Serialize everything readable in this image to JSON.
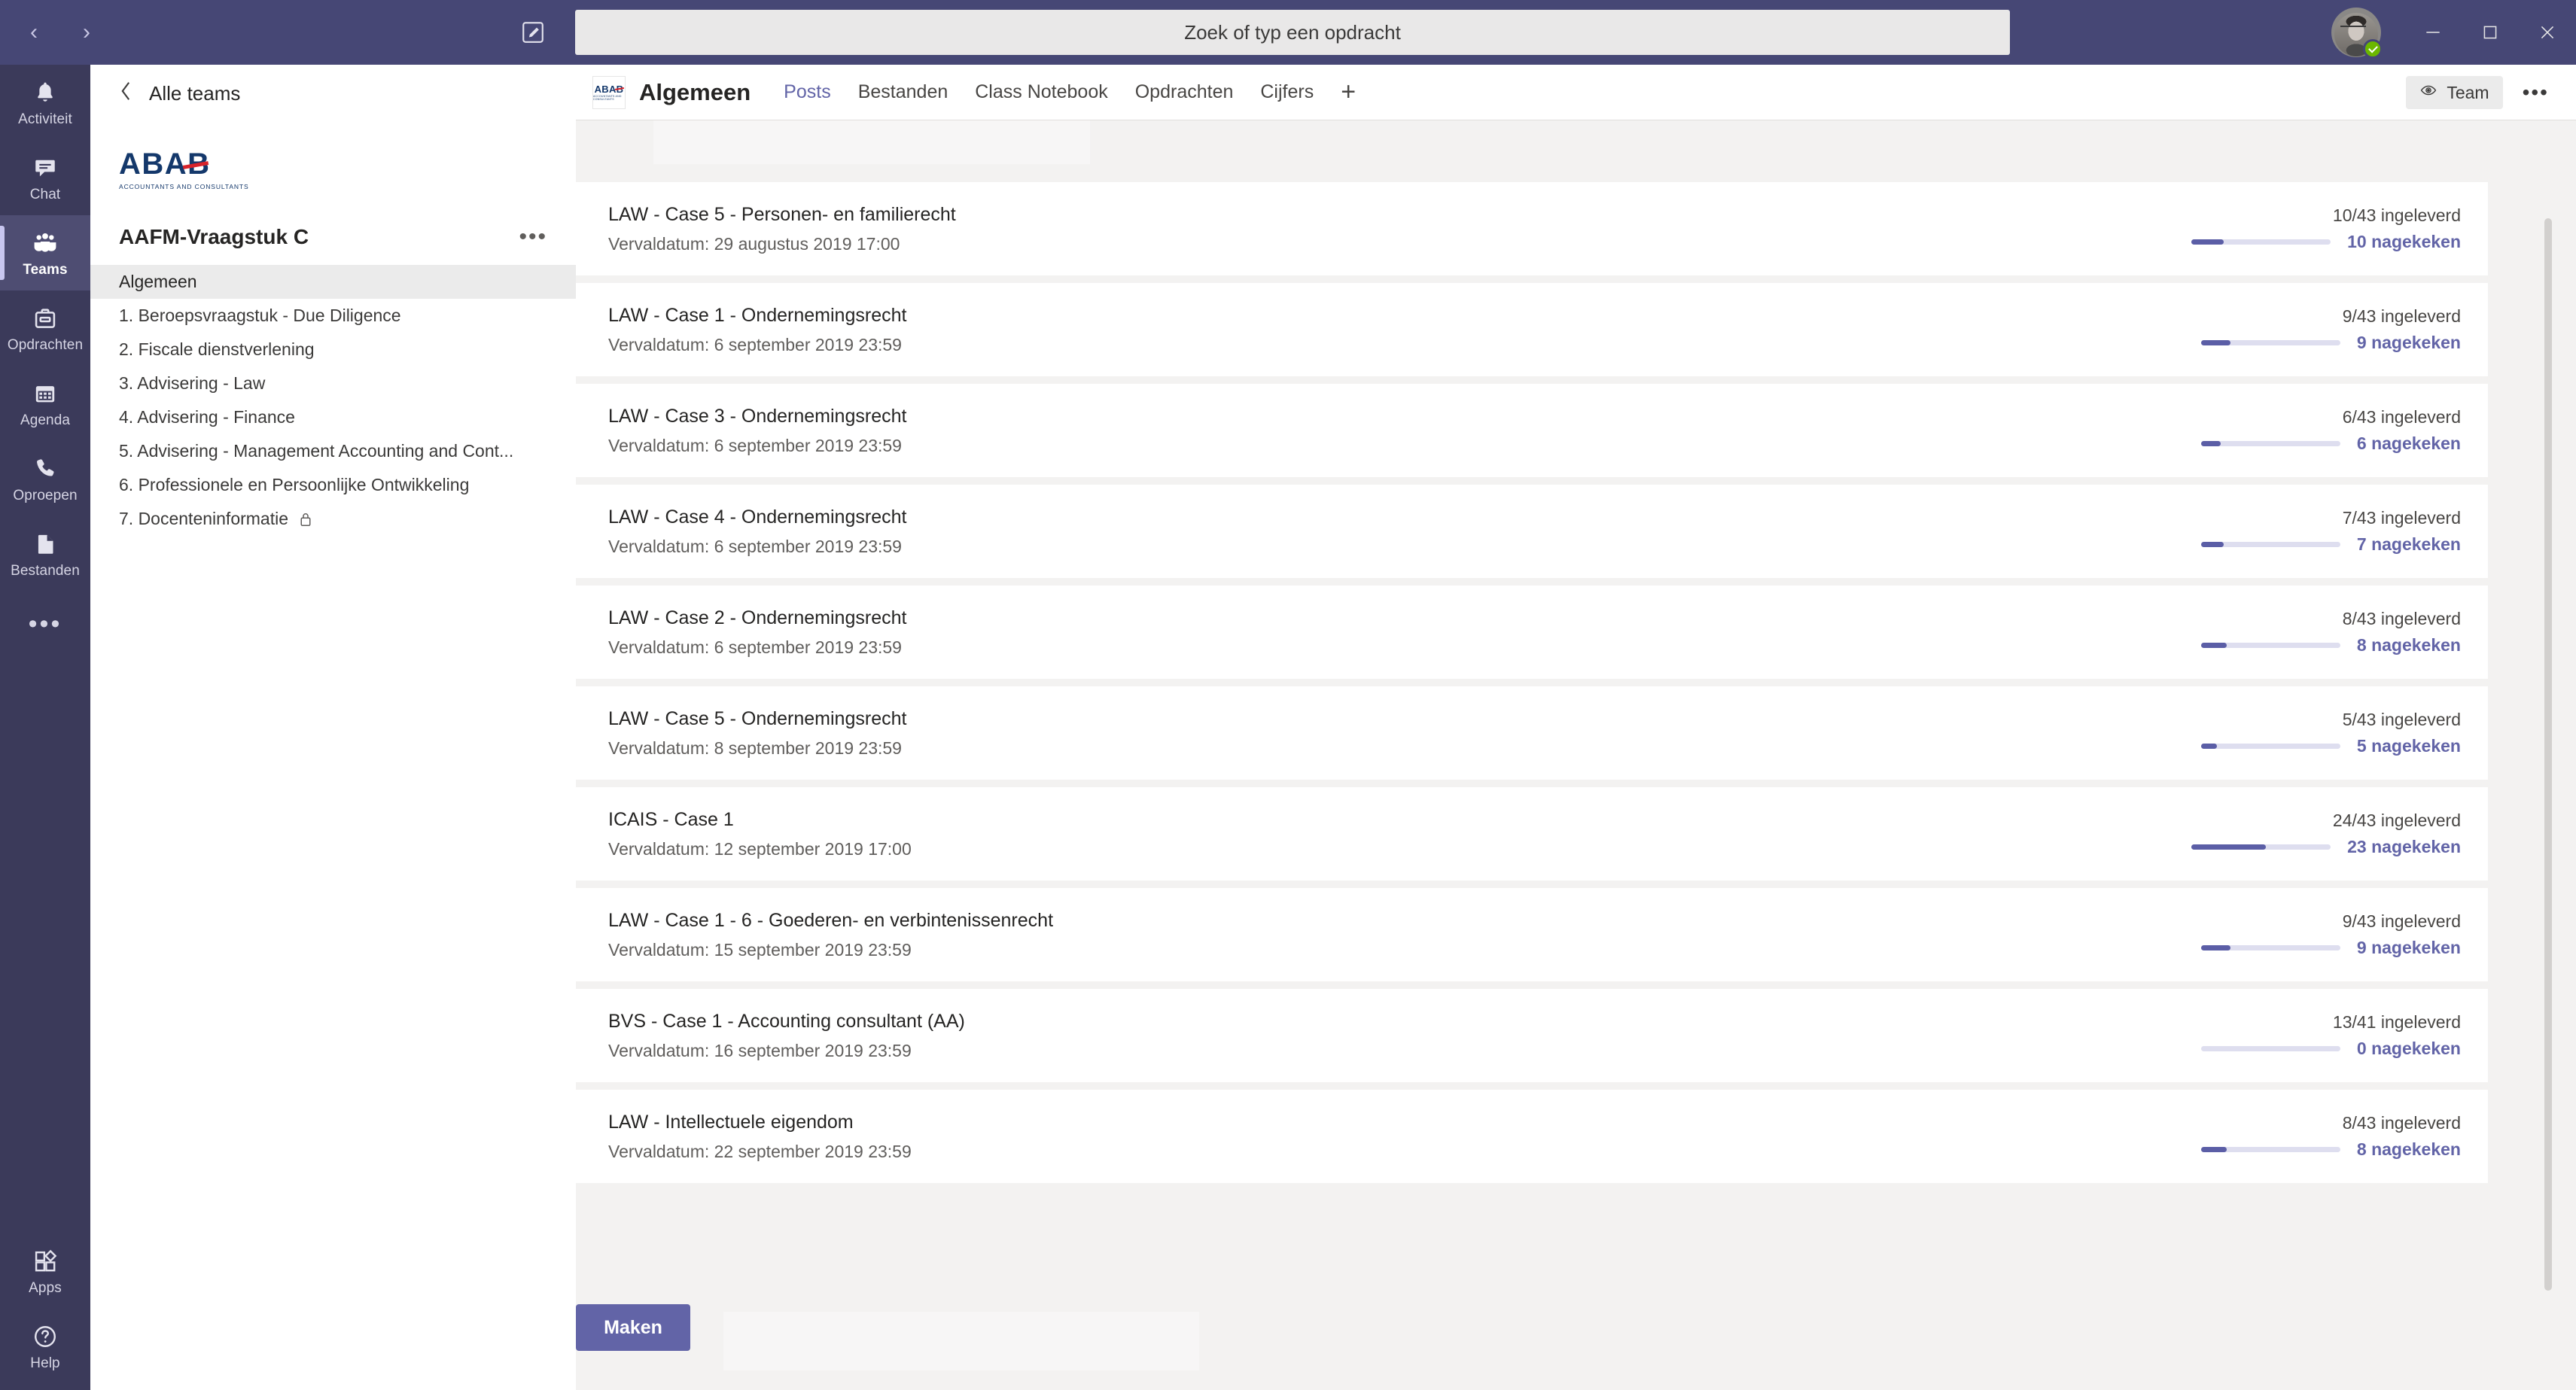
{
  "titlebar": {
    "back_label": "‹",
    "forward_label": "›",
    "search_placeholder": "Zoek of typ een opdracht",
    "search_value": "Zoek of typ een opdracht",
    "minimize_label": "—",
    "maximize_label": "□",
    "close_label": "✕"
  },
  "rail": {
    "items": [
      {
        "label": "Activiteit",
        "icon": "bell-icon"
      },
      {
        "label": "Chat",
        "icon": "chat-icon"
      },
      {
        "label": "Teams",
        "icon": "teams-icon"
      },
      {
        "label": "Opdrachten",
        "icon": "assignments-icon"
      },
      {
        "label": "Agenda",
        "icon": "calendar-icon"
      },
      {
        "label": "Oproepen",
        "icon": "phone-icon"
      },
      {
        "label": "Bestanden",
        "icon": "files-icon"
      }
    ],
    "more_label": "•••",
    "bottom": [
      {
        "label": "Apps",
        "icon": "apps-icon"
      },
      {
        "label": "Help",
        "icon": "help-icon"
      }
    ]
  },
  "sidebar": {
    "all_teams_label": "Alle teams",
    "logo_text": "ABAB",
    "logo_tagline": "ACCOUNTANTS AND CONSULTANTS",
    "team_name": "AAFM-Vraagstuk C",
    "team_more_label": "•••",
    "channels": [
      {
        "label": "Algemeen",
        "selected": true,
        "private": false
      },
      {
        "label": "1. Beroepsvraagstuk - Due Diligence",
        "selected": false,
        "private": false
      },
      {
        "label": "2. Fiscale dienstverlening",
        "selected": false,
        "private": false
      },
      {
        "label": "3. Advisering - Law",
        "selected": false,
        "private": false
      },
      {
        "label": "4. Advisering - Finance",
        "selected": false,
        "private": false
      },
      {
        "label": "5. Advisering - Management Accounting and Cont...",
        "selected": false,
        "private": false
      },
      {
        "label": "6. Professionele en Persoonlijke Ontwikkeling",
        "selected": false,
        "private": false
      },
      {
        "label": "7. Docenteninformatie",
        "selected": false,
        "private": true
      }
    ]
  },
  "main": {
    "channel_avatar_text": "ABAB",
    "channel_avatar_tagline": "ACCOUNTANTS AND CONSULTANTS",
    "channel_title": "Algemeen",
    "tabs": [
      {
        "label": "Posts",
        "active": true
      },
      {
        "label": "Bestanden",
        "active": false
      },
      {
        "label": "Class Notebook",
        "active": false
      },
      {
        "label": "Opdrachten",
        "active": false
      },
      {
        "label": "Cijfers",
        "active": false
      }
    ],
    "add_tab_label": "+",
    "team_pill_label": "Team",
    "more_label": "•••",
    "create_button_label": "Maken",
    "assignments": [
      {
        "title": "LAW - Case 5 - Personen- en familierecht",
        "due": "Vervaldatum: 29 augustus 2019 17:00",
        "submitted": "10/43 ingeleverd",
        "graded": "10 nagekeken",
        "graded_count": 10,
        "total": 43
      },
      {
        "title": "LAW - Case 1 - Ondernemingsrecht",
        "due": "Vervaldatum: 6 september 2019 23:59",
        "submitted": "9/43 ingeleverd",
        "graded": "9 nagekeken",
        "graded_count": 9,
        "total": 43
      },
      {
        "title": "LAW - Case 3 - Ondernemingsrecht",
        "due": "Vervaldatum: 6 september 2019 23:59",
        "submitted": "6/43 ingeleverd",
        "graded": "6 nagekeken",
        "graded_count": 6,
        "total": 43
      },
      {
        "title": "LAW - Case 4 - Ondernemingsrecht",
        "due": "Vervaldatum: 6 september 2019 23:59",
        "submitted": "7/43 ingeleverd",
        "graded": "7 nagekeken",
        "graded_count": 7,
        "total": 43
      },
      {
        "title": "LAW - Case 2 - Ondernemingsrecht",
        "due": "Vervaldatum: 6 september 2019 23:59",
        "submitted": "8/43 ingeleverd",
        "graded": "8 nagekeken",
        "graded_count": 8,
        "total": 43
      },
      {
        "title": "LAW - Case 5 - Ondernemingsrecht",
        "due": "Vervaldatum: 8 september 2019 23:59",
        "submitted": "5/43 ingeleverd",
        "graded": "5 nagekeken",
        "graded_count": 5,
        "total": 43
      },
      {
        "title": "ICAIS - Case 1",
        "due": "Vervaldatum: 12 september 2019 17:00",
        "submitted": "24/43 ingeleverd",
        "graded": "23 nagekeken",
        "graded_count": 23,
        "total": 43
      },
      {
        "title": "LAW - Case 1 - 6 - Goederen- en verbintenissenrecht",
        "due": "Vervaldatum: 15 september 2019 23:59",
        "submitted": "9/43 ingeleverd",
        "graded": "9 nagekeken",
        "graded_count": 9,
        "total": 43
      },
      {
        "title": "BVS - Case 1 - Accounting consultant (AA)",
        "due": "Vervaldatum: 16 september 2019 23:59",
        "submitted": "13/41 ingeleverd",
        "graded": "0 nagekeken",
        "graded_count": 0,
        "total": 41
      },
      {
        "title": "LAW - Intellectuele eigendom",
        "due": "Vervaldatum: 22 september 2019 23:59",
        "submitted": "8/43 ingeleverd",
        "graded": "8 nagekeken",
        "graded_count": 8,
        "total": 43
      }
    ]
  },
  "colors": {
    "titlebar": "#464775",
    "rail": "#3b3a5a",
    "accent": "#6264a7",
    "progress_fill": "#5b5ea6",
    "progress_track": "#dedeef",
    "canvas": "#f3f2f1",
    "presence_available": "#6bb700",
    "logo_blue": "#14386b",
    "logo_red": "#d8232a"
  }
}
